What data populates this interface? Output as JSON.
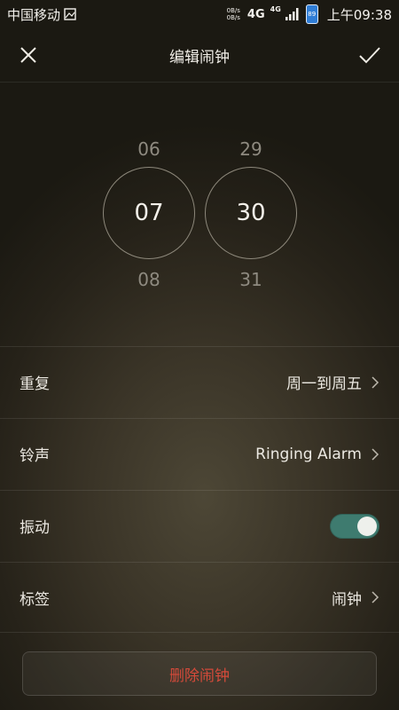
{
  "status_bar": {
    "carrier": "中国移动",
    "net_speed_up": "0B/s",
    "net_speed_down": "0B/s",
    "network_1": "4G",
    "network_2": "4G",
    "battery_level": "89",
    "time": "上午09:38"
  },
  "header": {
    "title": "编辑闹钟"
  },
  "picker": {
    "hour_prev": "06",
    "hour": "07",
    "hour_next": "08",
    "minute_prev": "29",
    "minute": "30",
    "minute_next": "31"
  },
  "settings": {
    "repeat": {
      "label": "重复",
      "value": "周一到周五"
    },
    "ringtone": {
      "label": "铃声",
      "value": "Ringing Alarm"
    },
    "vibrate": {
      "label": "振动",
      "enabled": true
    },
    "tag": {
      "label": "标签",
      "value": "闹钟"
    }
  },
  "delete_label": "删除闹钟",
  "colors": {
    "toggle_on": "#3e7b6f",
    "delete_text": "#d44a3a"
  }
}
